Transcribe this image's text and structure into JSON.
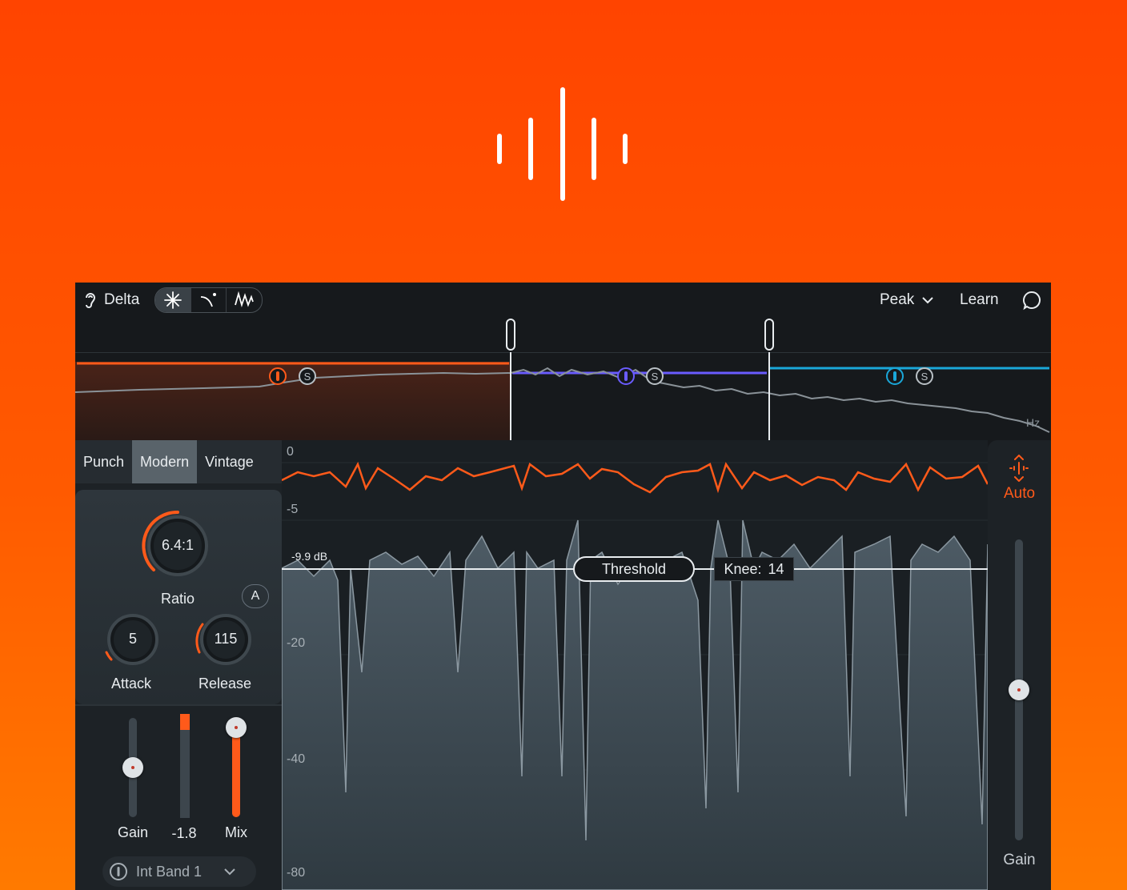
{
  "topbar": {
    "delta_label": "Delta",
    "detection_mode": "Peak",
    "learn_label": "Learn"
  },
  "bands_view": {
    "unit_label": "Hz",
    "band_colors": [
      "#ff5a1a",
      "#6a5cff",
      "#1aa7d9"
    ],
    "solo_label": "S"
  },
  "presets": [
    "Punch",
    "Modern",
    "Vintage"
  ],
  "active_preset": "Modern",
  "knobs": {
    "ratio": {
      "value": "6.4:1",
      "label": "Ratio"
    },
    "attack": {
      "value": "5",
      "label": "Attack"
    },
    "release": {
      "value": "115",
      "label": "Release"
    },
    "auto_label": "A"
  },
  "faders": {
    "gain": {
      "label": "Gain",
      "level": 0.5
    },
    "meter": {
      "label": "-1.8",
      "level": 0.85
    },
    "mix": {
      "label": "Mix",
      "level": 0.9
    }
  },
  "band_select": {
    "value": "Int Band 1"
  },
  "graph": {
    "axis_labels": [
      "0",
      "-5",
      "-20",
      "-40",
      "-80"
    ],
    "threshold_value": "-9.9 dB",
    "threshold_label": "Threshold",
    "knee_label": "Knee:",
    "knee_value": "14"
  },
  "right_panel": {
    "auto_label": "Auto",
    "gain_label": "Gain",
    "gain_level": 0.5
  },
  "colors": {
    "accent": "#ff5a1a",
    "band2": "#6a5cff",
    "band3": "#1aa7d9"
  }
}
